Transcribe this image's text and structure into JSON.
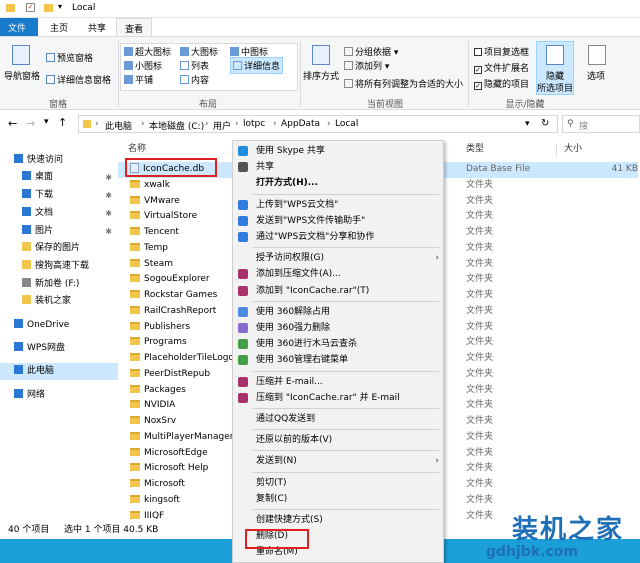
{
  "title": "Local",
  "tabs": [
    "文件",
    "主页",
    "共享",
    "查看"
  ],
  "ribbon": {
    "nav_pane": "导航窗格",
    "preview_pane": "预览窗格",
    "details_pane": "详细信息窗格",
    "pane_group": "窗格",
    "layout": [
      "超大图标",
      "大图标",
      "中图标",
      "小图标",
      "列表",
      "详细信息",
      "平铺",
      "内容"
    ],
    "layout_group": "布局",
    "sort_by": "排序方式",
    "group_by": "分组依据",
    "add_col": "添加列",
    "fit_cols": "将所有列调整为合适的大小",
    "current_view_group": "当前视图",
    "item_checkbox": "项目复选框",
    "file_ext": "文件扩展名",
    "hidden_items": "隐藏的项目",
    "hide_selected": "隐藏",
    "hide_selected2": "所选项目",
    "options": "选项",
    "showhide_group": "显示/隐藏"
  },
  "address": [
    "此电脑",
    "本地磁盘 (C:)",
    "用户",
    "lotpc",
    "AppData",
    "Local"
  ],
  "search_placeholder": "搜",
  "nav": [
    {
      "label": "快速访问",
      "pin": false
    },
    {
      "label": "桌面",
      "pin": true
    },
    {
      "label": "下载",
      "pin": true
    },
    {
      "label": "文档",
      "pin": true
    },
    {
      "label": "图片",
      "pin": true
    },
    {
      "label": "保存的图片",
      "pin": false
    },
    {
      "label": "搜狗高速下载",
      "pin": false
    },
    {
      "label": "新加卷 (F:)",
      "pin": false
    },
    {
      "label": "装机之家",
      "pin": false
    },
    {
      "label": "OneDrive",
      "pin": false
    },
    {
      "label": "WPS网盘",
      "pin": false
    },
    {
      "label": "此电脑",
      "pin": false
    },
    {
      "label": "网络",
      "pin": false
    }
  ],
  "columns": {
    "name": "名称",
    "type": "类型",
    "size": "大小"
  },
  "files": [
    {
      "name": "IconCache.db",
      "type": "Data Base File",
      "size": "41 KB"
    },
    {
      "name": "xwalk",
      "type": "文件夹",
      "size": ""
    },
    {
      "name": "VMware",
      "type": "文件夹",
      "size": ""
    },
    {
      "name": "VirtualStore",
      "type": "文件夹",
      "size": ""
    },
    {
      "name": "Tencent",
      "type": "文件夹",
      "size": ""
    },
    {
      "name": "Temp",
      "type": "文件夹",
      "size": ""
    },
    {
      "name": "Steam",
      "type": "文件夹",
      "size": ""
    },
    {
      "name": "SogouExplorer",
      "type": "文件夹",
      "size": ""
    },
    {
      "name": "Rockstar Games",
      "type": "文件夹",
      "size": ""
    },
    {
      "name": "RailCrashReport",
      "type": "文件夹",
      "size": ""
    },
    {
      "name": "Publishers",
      "type": "文件夹",
      "size": ""
    },
    {
      "name": "Programs",
      "type": "文件夹",
      "size": ""
    },
    {
      "name": "PlaceholderTileLogo",
      "type": "文件夹",
      "size": ""
    },
    {
      "name": "PeerDistRepub",
      "type": "文件夹",
      "size": ""
    },
    {
      "name": "Packages",
      "type": "文件夹",
      "size": ""
    },
    {
      "name": "NVIDIA",
      "type": "文件夹",
      "size": ""
    },
    {
      "name": "NoxSrv",
      "type": "文件夹",
      "size": ""
    },
    {
      "name": "MultiPlayerManager",
      "type": "文件夹",
      "size": ""
    },
    {
      "name": "MicrosoftEdge",
      "type": "文件夹",
      "size": ""
    },
    {
      "name": "Microsoft Help",
      "type": "文件夹",
      "size": ""
    },
    {
      "name": "Microsoft",
      "type": "文件夹",
      "size": ""
    },
    {
      "name": "kingsoft",
      "type": "文件夹",
      "size": ""
    },
    {
      "name": "IIIQF",
      "type": "文件夹",
      "size": ""
    }
  ],
  "status": {
    "count": "40 个项目",
    "selected": "选中 1 个项目  40.5 KB"
  },
  "menu": [
    {
      "label": "使用 Skype 共享",
      "icon": "#1e8fe0"
    },
    {
      "label": "共享",
      "icon": "#555"
    },
    {
      "label": "打开方式(H)...",
      "icon": ""
    },
    {
      "sep": true
    },
    {
      "label": "上传到\"WPS云文档\"",
      "icon": "#2f7de1"
    },
    {
      "label": "发送到\"WPS文件传输助手\"",
      "icon": "#2f7de1"
    },
    {
      "label": "通过\"WPS云文档\"分享和协作",
      "icon": "#2f7de1"
    },
    {
      "sep": true
    },
    {
      "label": "授予访问权限(G)",
      "icon": "",
      "arrow": true
    },
    {
      "label": "添加到压缩文件(A)...",
      "icon": "#a8326b"
    },
    {
      "label": "添加到 \"IconCache.rar\"(T)",
      "icon": "#a8326b"
    },
    {
      "sep": true
    },
    {
      "label": "使用 360解除占用",
      "icon": "#4a8be0"
    },
    {
      "label": "使用 360强力删除",
      "icon": "#8a6ad0"
    },
    {
      "label": "使用 360进行木马云查杀",
      "icon": "#43a047"
    },
    {
      "label": "使用 360管理右键菜单",
      "icon": "#43a047"
    },
    {
      "sep": true
    },
    {
      "label": "压缩并 E-mail...",
      "icon": "#a8326b"
    },
    {
      "label": "压缩到 \"IconCache.rar\" 并 E-mail",
      "icon": "#a8326b"
    },
    {
      "sep": true
    },
    {
      "label": "通过QQ发送到",
      "icon": ""
    },
    {
      "sep": true
    },
    {
      "label": "还原以前的版本(V)",
      "icon": ""
    },
    {
      "sep": true
    },
    {
      "label": "发送到(N)",
      "icon": "",
      "arrow": true
    },
    {
      "sep": true
    },
    {
      "label": "剪切(T)",
      "icon": ""
    },
    {
      "label": "复制(C)",
      "icon": ""
    },
    {
      "sep": true
    },
    {
      "label": "创建快捷方式(S)",
      "icon": ""
    },
    {
      "label": "删除(D)",
      "icon": ""
    },
    {
      "label": "重命名(M)",
      "icon": ""
    }
  ],
  "watermark": "装机之家",
  "watermark_url": "gdhjbk.com"
}
